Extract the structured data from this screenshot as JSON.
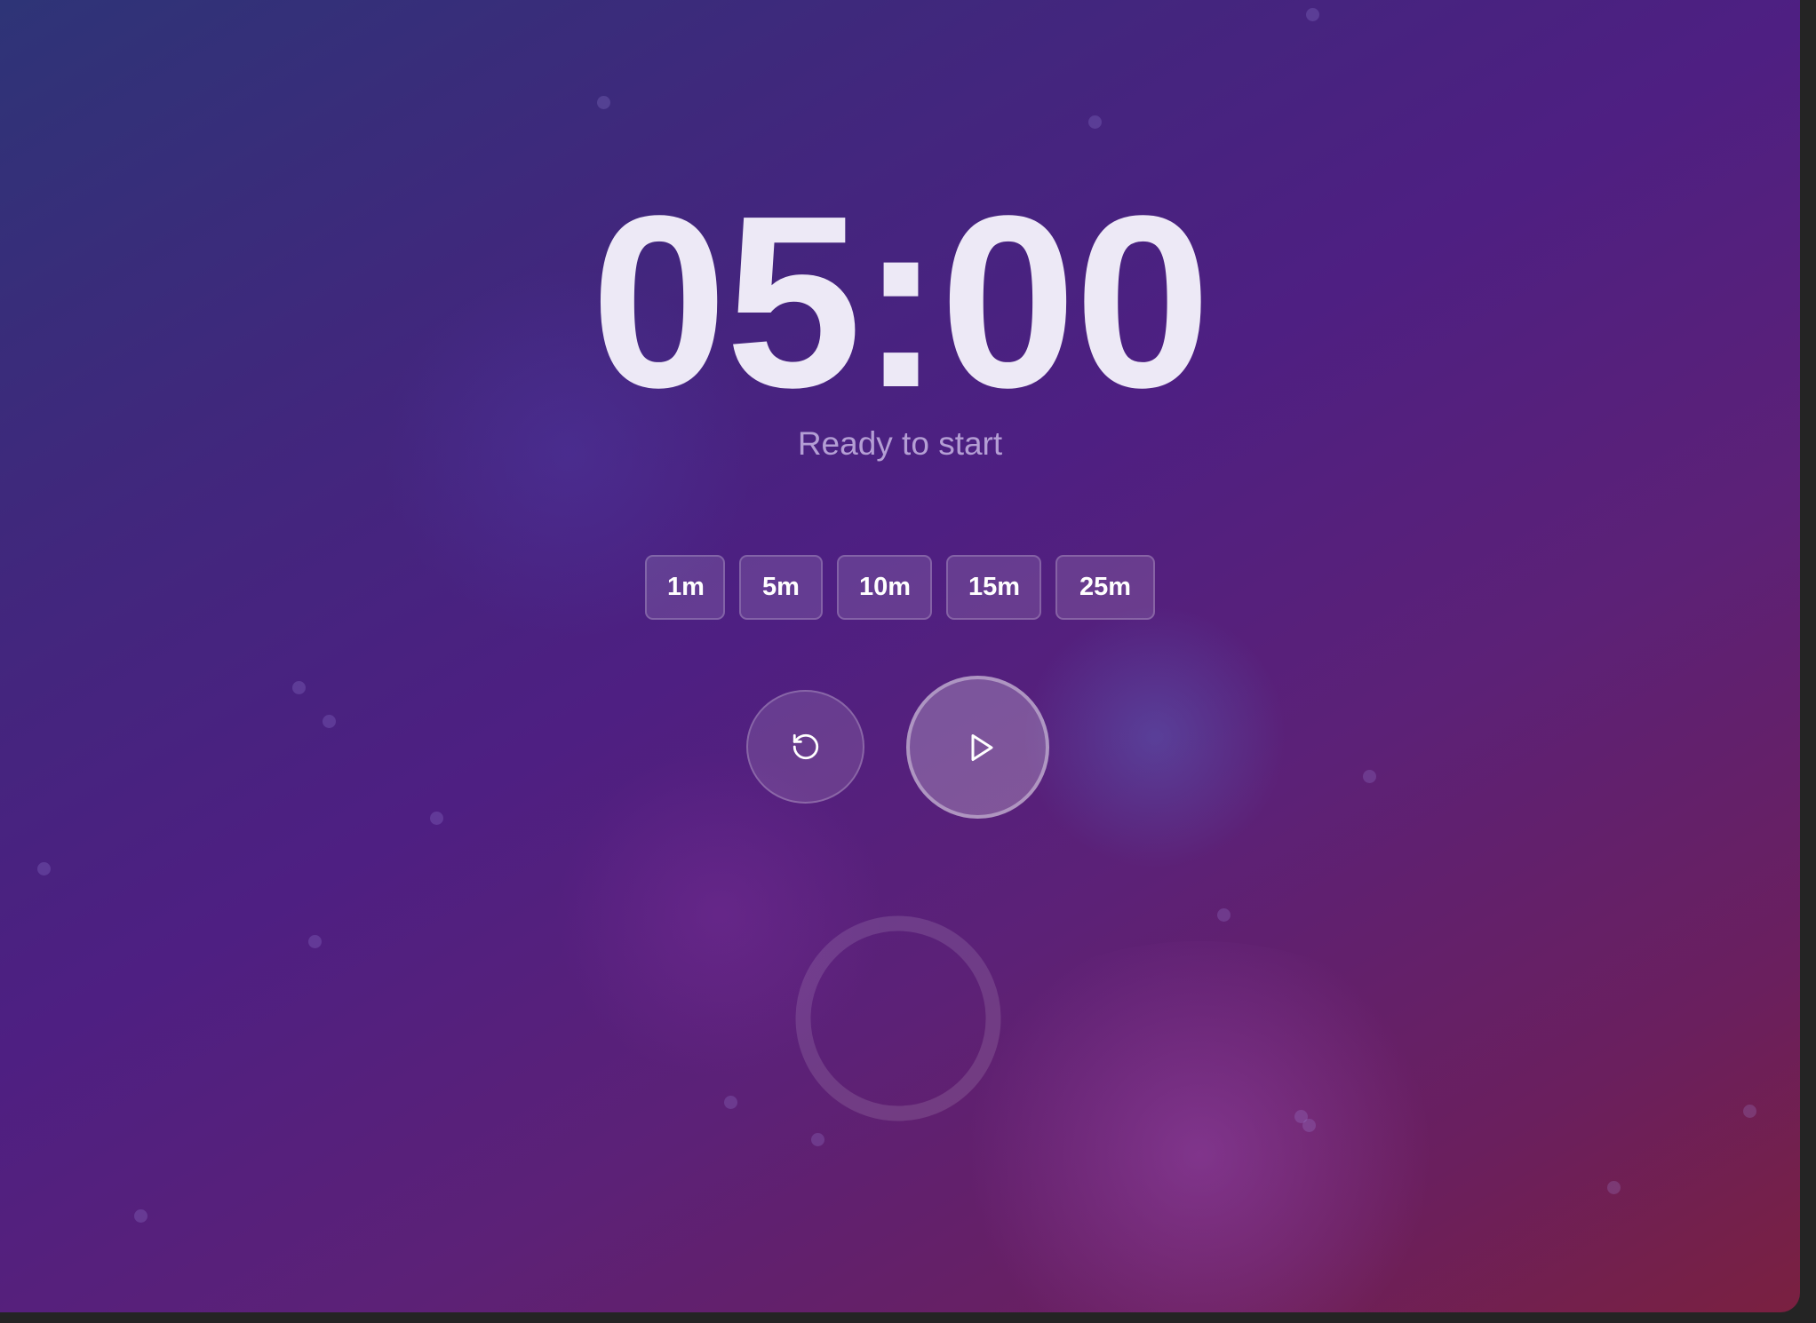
{
  "timer": {
    "display": "05:00",
    "status": "Ready to start"
  },
  "presets": [
    {
      "label": "1m"
    },
    {
      "label": "5m"
    },
    {
      "label": "10m"
    },
    {
      "label": "15m"
    },
    {
      "label": "25m"
    }
  ],
  "controls": {
    "reset_icon": "rotate-ccw-icon",
    "play_icon": "play-icon"
  },
  "progress": {
    "fraction": 0
  },
  "colors": {
    "text_primary": "#ede9f6",
    "gradient_start": "#2e3477",
    "gradient_mid": "#4e1f82",
    "gradient_end": "#7a2040"
  }
}
